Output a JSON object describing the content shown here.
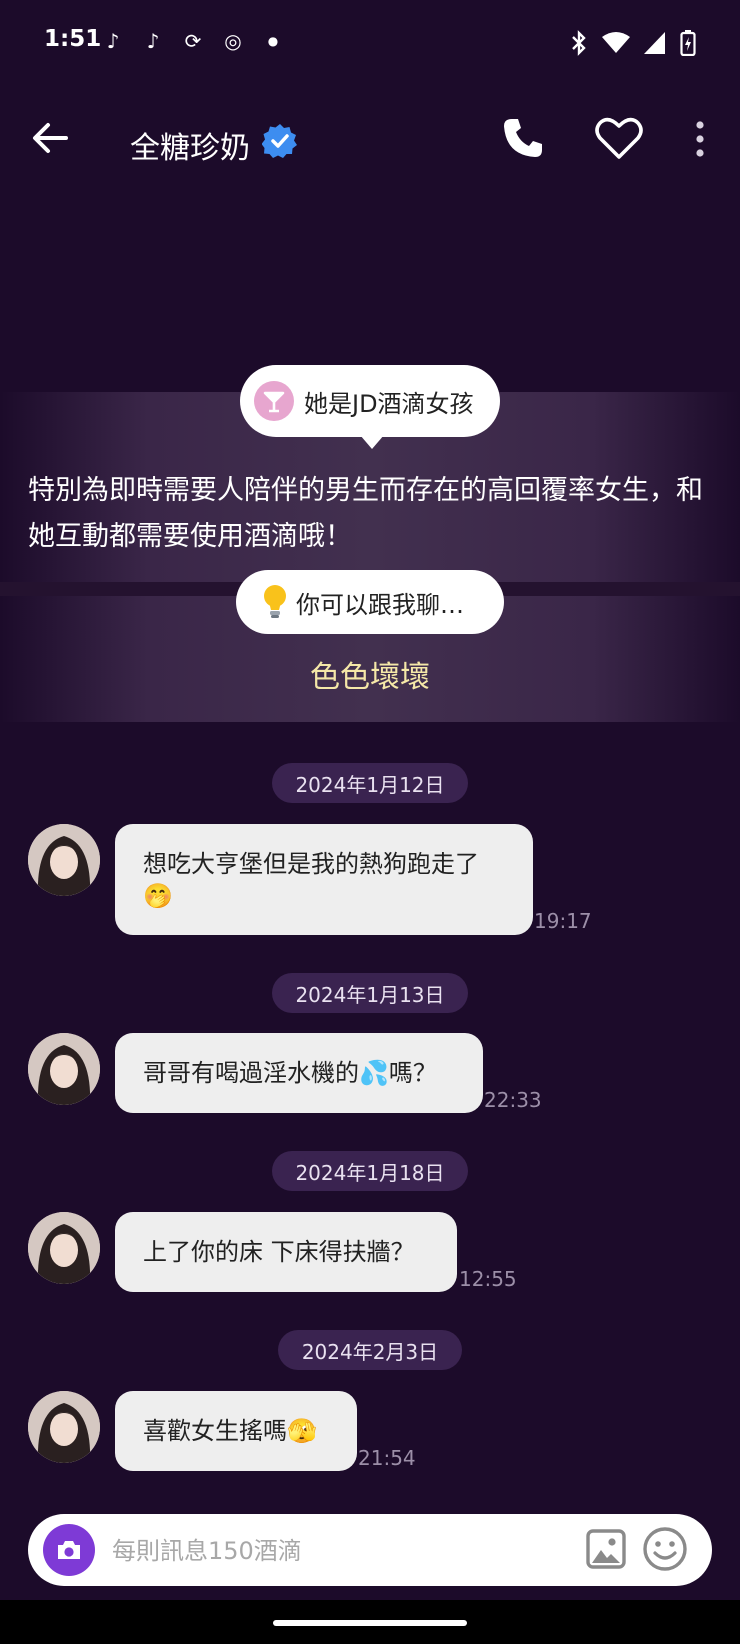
{
  "status": {
    "time": "1:51",
    "apps": [
      "tiktok-icon",
      "tiktok-icon",
      "sync-icon",
      "messenger-icon",
      "dot-icon"
    ],
    "right_icons": [
      "bluetooth-icon",
      "wifi-icon",
      "signal-icon",
      "battery-charging-icon"
    ]
  },
  "header": {
    "title": "全糖珍奶",
    "verified": true
  },
  "intro": {
    "identity_label": "她是JD酒滴女孩",
    "description": "特別為即時需要人陪伴的男生而存在的高回覆率女生，和她互動都需要使用酒滴哦！",
    "suggest_label": "你可以跟我聊…",
    "topic": "色色壞壞"
  },
  "messages": [
    {
      "date": "2024年1月12日",
      "text": "想吃大亨堡但是我的熱狗跑走了 🤭",
      "time": "19:17"
    },
    {
      "date": "2024年1月13日",
      "text": "哥哥有喝過淫水機的💦嗎？",
      "time": "22:33"
    },
    {
      "date": "2024年1月18日",
      "text": "上了你的床 下床得扶牆？",
      "time": "12:55"
    },
    {
      "date": "2024年2月3日",
      "text": "喜歡女生搖嗎🫣",
      "time": "21:54"
    }
  ],
  "composer": {
    "placeholder": "每則訊息150酒滴"
  },
  "colors": {
    "background": "#1c0b2a",
    "accent": "#7e3ad6",
    "date_chip": "#3a2350",
    "topic": "#f5e8a8"
  }
}
